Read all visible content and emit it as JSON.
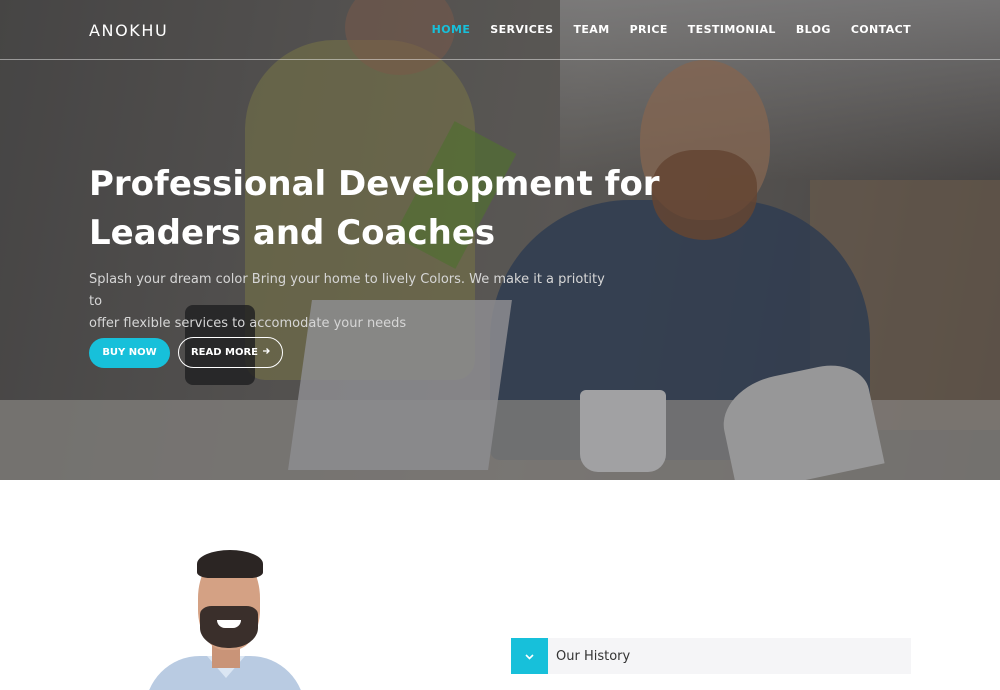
{
  "brand": {
    "logo": "ANOKHU"
  },
  "nav": {
    "items": [
      {
        "label": "HOME",
        "active": true
      },
      {
        "label": "SERVICES",
        "active": false
      },
      {
        "label": "TEAM",
        "active": false
      },
      {
        "label": "PRICE",
        "active": false
      },
      {
        "label": "TESTIMONIAL",
        "active": false
      },
      {
        "label": "BLOG",
        "active": false
      },
      {
        "label": "CONTACT",
        "active": false
      }
    ]
  },
  "hero": {
    "title_line1": "Professional Development for",
    "title_line2": "Leaders and Coaches",
    "subtitle_line1": "Splash your dream color Bring your home to lively Colors. We make it a priotity to",
    "subtitle_line2": "offer flexible services to accomodate your needs",
    "buy_label": "BUY NOW",
    "read_label": "READ MORE",
    "read_icon": "arrow-right-icon"
  },
  "about": {
    "accordion_title": "Our History",
    "accordion_icon": "chevron-down-icon"
  },
  "colors": {
    "accent": "#17c0da",
    "text_dark": "#333333",
    "accordion_bg": "#f5f5f7"
  }
}
